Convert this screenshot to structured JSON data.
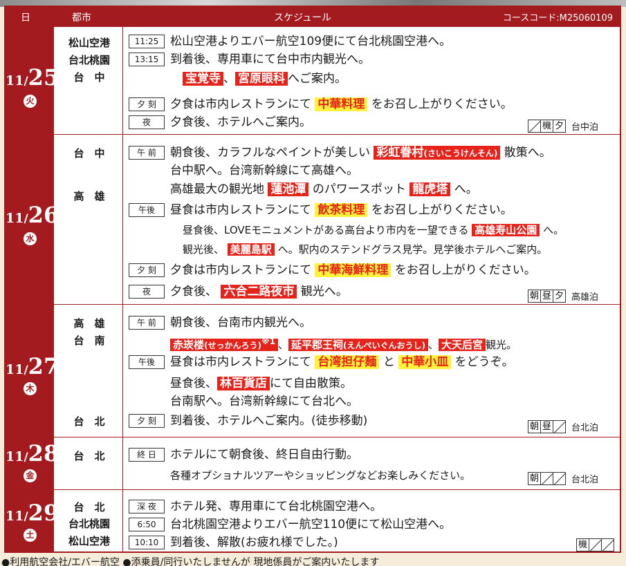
{
  "header": {
    "day": "日",
    "city": "都市",
    "schedule": "スケジュール",
    "course_code": "コースコード:M25060109"
  },
  "days": [
    {
      "month": "11",
      "day": "25",
      "weekday": "火",
      "cities": [
        "松山空港",
        "台北桃園",
        "台　中"
      ],
      "lines": [
        {
          "tag": "11:25",
          "text": "松山空港よりエバー航空109便にて台北桃園空港へ。"
        },
        {
          "tag": "13:15",
          "text": "到着後、専用車にて台中市内観光へ。"
        },
        {
          "spot1": "宝覚寺",
          "sep": "、",
          "spot2": "宮原眼科",
          "tail": "へご案内。"
        },
        {
          "tag": "夕 刻",
          "pre": "夕食は市内レストランにて",
          "food": "中華料理",
          "tail": "をお召し上がりください。"
        },
        {
          "tag": "夜",
          "text": "夕食後、ホテルへご案内。"
        }
      ],
      "meals": [
        "none",
        "機",
        "夕"
      ],
      "stay": "台中泊"
    },
    {
      "month": "11",
      "day": "26",
      "weekday": "水",
      "cities": [
        "台　中",
        "高　雄"
      ],
      "lines": [
        {
          "tag": "午 前",
          "pre": "朝食後、カラフルなペイントが美しい",
          "spot": "彩虹眷村",
          "ruby": "(さいこうけんそん)",
          "tail": "散策へ。"
        },
        {
          "text": "台中駅へ。台湾新幹線にて高雄へ。"
        },
        {
          "pre": "高雄最大の観光地",
          "spot1": "蓮池潭",
          "mid": "のパワースポット",
          "spot2": "龍虎塔",
          "tail": "へ。"
        },
        {
          "tag": "午後",
          "pre": "昼食は市内レストランにて",
          "food": "飲茶料理",
          "tail": "をお召し上がりください。"
        },
        {
          "pre": "昼食後、LOVEモニュメントがある高台より市内を一望できる",
          "spot": "高雄寿山公園",
          "tail": "へ。"
        },
        {
          "pre": "観光後、",
          "spot": "美麗島駅",
          "tail": "へ。駅内のステンドグラス見学。見学後ホテルへご案内。"
        },
        {
          "tag": "夕 刻",
          "pre": "夕食は市内レストランにて",
          "food": "中華海鮮料理",
          "tail": "をお召し上がりください。"
        },
        {
          "tag": "夜",
          "pre": "夕食後、",
          "spot": "六合二路夜市",
          "tail": "観光へ。"
        }
      ],
      "meals": [
        "朝",
        "昼",
        "夕"
      ],
      "stay": "高雄泊"
    },
    {
      "month": "11",
      "day": "27",
      "weekday": "木",
      "cities": [
        "高　雄",
        "台　南",
        "台　北"
      ],
      "lines": [
        {
          "tag": "午 前",
          "text": "朝食後、台南市内観光へ。"
        },
        {
          "spot1": "赤崁楼",
          "ruby1": "(せっかんろう)",
          "note": "※1",
          "sep1": "、",
          "spot2": "延平郡王祠",
          "ruby2": "(えんぺいぐんおうし)",
          "sep2": "、",
          "spot3": "大天后宮",
          "tail": "観光。"
        },
        {
          "tag": "午後",
          "pre": "昼食は市内レストランにて",
          "food1": "台湾担仔麺",
          "mid": "と",
          "food2": "中華小皿",
          "tail": "をどうぞ。"
        },
        {
          "pre": "昼食後、",
          "spot": "林百貨店",
          "tail": "にて自由散策。"
        },
        {
          "text": "台南駅へ。台湾新幹線にて台北へ。"
        },
        {
          "tag": "夕 刻",
          "text": "到着後、ホテルへご案内。(徒歩移動)"
        }
      ],
      "meals": [
        "朝",
        "昼",
        "none"
      ],
      "stay": "台北泊"
    },
    {
      "month": "11",
      "day": "28",
      "weekday": "金",
      "cities": [
        "台　北"
      ],
      "lines": [
        {
          "tag": "終 日",
          "text": "ホテルにて朝食後、終日自由行動。"
        },
        {
          "text": "各種オプショナルツアーやショッピングなどお楽しみください。"
        }
      ],
      "meals": [
        "朝",
        "none",
        "none"
      ],
      "stay": "台北泊"
    },
    {
      "month": "11",
      "day": "29",
      "weekday": "土",
      "cities": [
        "台　北",
        "台北桃園",
        "松山空港"
      ],
      "lines": [
        {
          "tag": "深 夜",
          "text": "ホテル発、専用車にて台北桃園空港へ。"
        },
        {
          "tag": "6:50",
          "text": "台北桃園空港よりエバー航空110便にて松山空港へ。"
        },
        {
          "tag": "10:10",
          "text": "到着後、解散(お疲れ様でした。)"
        }
      ],
      "meals": [
        "機",
        "none",
        "none"
      ],
      "stay": ""
    }
  ],
  "footer": "●利用航空会社/エバー航空 ●添乗員/同行いたしませんが 現地係員がご案内いたします"
}
